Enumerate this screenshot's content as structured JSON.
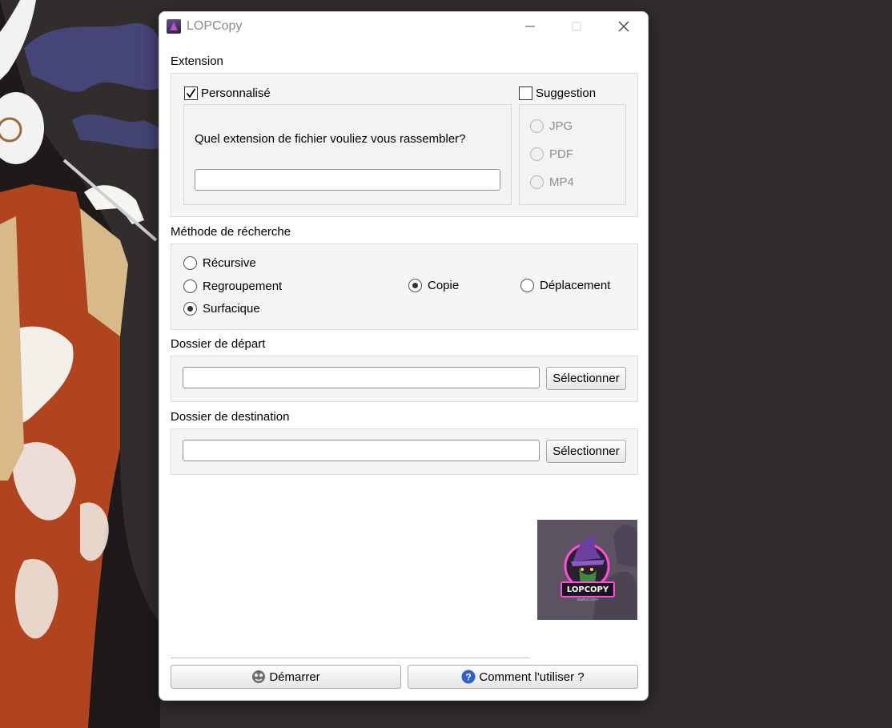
{
  "window": {
    "title": "LOPCopy"
  },
  "extension": {
    "section_label": "Extension",
    "custom_checkbox_label": "Personnalisé",
    "custom_checked": true,
    "prompt": "Quel extension de fichier vouliez vous rassembler?",
    "input_value": "",
    "suggestion_checkbox_label": "Suggestion",
    "suggestion_checked": false,
    "suggestions": [
      "JPG",
      "PDF",
      "MP4"
    ]
  },
  "method": {
    "section_label": "Méthode de récherche",
    "options": [
      {
        "label": "Récursive",
        "checked": false
      },
      {
        "label": "Regroupement",
        "checked": false
      },
      {
        "label": "Surfacique",
        "checked": true
      },
      {
        "label": "Copie",
        "checked": true
      },
      {
        "label": "Déplacement",
        "checked": false
      }
    ]
  },
  "source": {
    "section_label": "Dossier de départ",
    "input_value": "",
    "button_label": "Sélectionner"
  },
  "destination": {
    "section_label": "Dossier de destination",
    "input_value": "",
    "button_label": "Sélectionner"
  },
  "logo": {
    "text": "LOPCOPY",
    "subtitle": "SIMPLE COPY"
  },
  "footer": {
    "start_label": "Démarrer",
    "help_label": "Comment l'utiliser ?"
  },
  "colors": {
    "accent": "#e040c0",
    "logo_bg": "#5b5362",
    "help_icon": "#2f5fd0"
  }
}
